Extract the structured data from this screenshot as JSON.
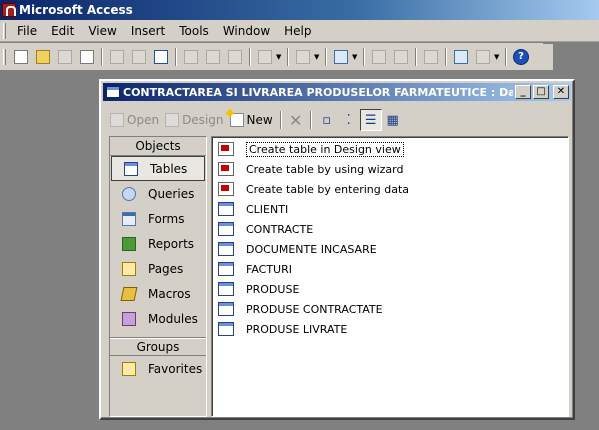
{
  "app": {
    "title": "Microsoft Access"
  },
  "menubar": {
    "items": [
      "File",
      "Edit",
      "View",
      "Insert",
      "Tools",
      "Window",
      "Help"
    ]
  },
  "toolbar": {
    "buttons": [
      "new-icon",
      "open-icon",
      "save-icon",
      "file-search-icon",
      "print-icon",
      "print-preview-icon",
      "spelling-icon",
      "cut-icon",
      "copy-icon",
      "paste-icon",
      "undo-icon",
      "analyze-icon",
      "office-links-icon",
      "code-icon",
      "properties-icon",
      "relationships-icon",
      "new-object-icon",
      "help-icon"
    ]
  },
  "db_window": {
    "title": "CONTRACTAREA SI LIVRAREA PRODUSELOR FARMATEUTICE : Databas...",
    "toolbar": {
      "open_label": "Open",
      "design_label": "Design",
      "new_label": "New"
    },
    "objects_header": "Objects",
    "objects": [
      {
        "label": "Tables",
        "icon": "tables-icon",
        "selected": true
      },
      {
        "label": "Queries",
        "icon": "queries-icon"
      },
      {
        "label": "Forms",
        "icon": "forms-icon"
      },
      {
        "label": "Reports",
        "icon": "reports-icon"
      },
      {
        "label": "Pages",
        "icon": "pages-icon"
      },
      {
        "label": "Macros",
        "icon": "macros-icon"
      },
      {
        "label": "Modules",
        "icon": "modules-icon"
      }
    ],
    "groups_header": "Groups",
    "groups": [
      {
        "label": "Favorites",
        "icon": "favorites-icon"
      }
    ],
    "list": [
      {
        "label": "Create table in Design view",
        "type": "shortcut",
        "focused": true
      },
      {
        "label": "Create table by using wizard",
        "type": "shortcut"
      },
      {
        "label": "Create table by entering data",
        "type": "shortcut"
      },
      {
        "label": "CLIENTI",
        "type": "table"
      },
      {
        "label": "CONTRACTE",
        "type": "table"
      },
      {
        "label": "DOCUMENTE INCASARE",
        "type": "table"
      },
      {
        "label": "FACTURI",
        "type": "table"
      },
      {
        "label": "PRODUSE",
        "type": "table"
      },
      {
        "label": "PRODUSE CONTRACTATE",
        "type": "table"
      },
      {
        "label": "PRODUSE LIVRATE",
        "type": "table"
      }
    ]
  }
}
